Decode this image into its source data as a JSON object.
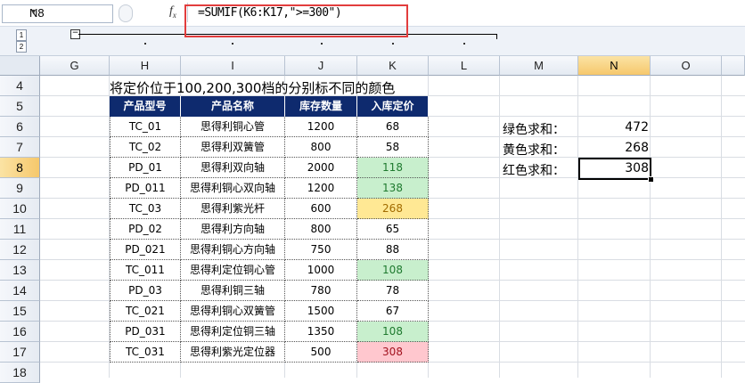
{
  "formula_bar": {
    "name_box": "N8",
    "fx": "f",
    "fx_sub": "x",
    "formula": "=SUMIF(K6:K17,\">=300\")"
  },
  "outline": {
    "levels": [
      "1",
      "2"
    ],
    "collapse": "−"
  },
  "columns": [
    "G",
    "H",
    "I",
    "J",
    "K",
    "L",
    "M",
    "N",
    "O"
  ],
  "rows": [
    "4",
    "5",
    "6",
    "7",
    "8",
    "9",
    "10",
    "11",
    "12",
    "13",
    "14",
    "15",
    "16",
    "17",
    "18"
  ],
  "selected": {
    "column": "N",
    "row": "8"
  },
  "sheet": {
    "title": "将定价位于100,200,300档的分别标不同的颜色",
    "headers": [
      "产品型号",
      "产品名称",
      "库存数量",
      "入库定价"
    ],
    "rows": [
      {
        "model": "TC_01",
        "name": "思得利铜心管",
        "qty": "1200",
        "price": "68",
        "fill": ""
      },
      {
        "model": "TC_02",
        "name": "思得利双簧管",
        "qty": "800",
        "price": "58",
        "fill": ""
      },
      {
        "model": "PD_01",
        "name": "思得利双向轴",
        "qty": "2000",
        "price": "118",
        "fill": "green"
      },
      {
        "model": "PD_011",
        "name": "思得利铜心双向轴",
        "qty": "1200",
        "price": "138",
        "fill": "green"
      },
      {
        "model": "TC_03",
        "name": "思得利紫光杆",
        "qty": "600",
        "price": "268",
        "fill": "yellow"
      },
      {
        "model": "PD_02",
        "name": "思得利方向轴",
        "qty": "800",
        "price": "65",
        "fill": ""
      },
      {
        "model": "PD_021",
        "name": "思得利铜心方向轴",
        "qty": "750",
        "price": "88",
        "fill": ""
      },
      {
        "model": "TC_011",
        "name": "思得利定位铜心管",
        "qty": "1000",
        "price": "108",
        "fill": "green"
      },
      {
        "model": "PD_03",
        "name": "思得利铜三轴",
        "qty": "780",
        "price": "78",
        "fill": ""
      },
      {
        "model": "TC_021",
        "name": "思得利铜心双簧管",
        "qty": "1500",
        "price": "67",
        "fill": ""
      },
      {
        "model": "PD_031",
        "name": "思得利定位铜三轴",
        "qty": "1350",
        "price": "108",
        "fill": "green"
      },
      {
        "model": "TC_031",
        "name": "思得利紫光定位器",
        "qty": "500",
        "price": "308",
        "fill": "red"
      }
    ],
    "sums": [
      {
        "label": "绿色求和：",
        "value": "472"
      },
      {
        "label": "黄色求和：",
        "value": "268"
      },
      {
        "label": "红色求和：",
        "value": "308"
      }
    ]
  },
  "colors": {
    "header_bg": "#0e2a6e",
    "green_fill": "#c8efcd",
    "yellow_fill": "#ffe894",
    "red_fill": "#ffc7ce",
    "highlight_box": "#e23d3d"
  }
}
